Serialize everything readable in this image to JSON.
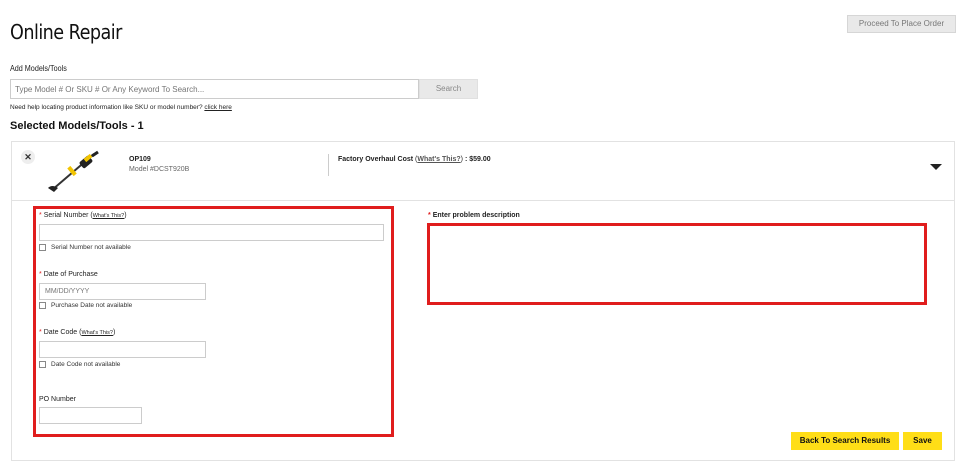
{
  "header": {
    "title": "Online Repair",
    "proceed_label": "Proceed To Place Order"
  },
  "search": {
    "label": "Add Models/Tools",
    "placeholder": "Type Model # Or SKU # Or Any Keyword To Search...",
    "button_label": "Search",
    "help_text": "Need help locating product information like SKU or model number?",
    "help_link": "click here"
  },
  "selected": {
    "title": "Selected Models/Tools - 1",
    "item": {
      "name": "OP109",
      "model": "Model #DCST920B",
      "cost_label": "Factory Overhaul Cost",
      "what_this": "What's This?",
      "cost_value": ": $59.00"
    }
  },
  "form": {
    "serial_label": "Serial Number",
    "serial_what": "What's This?",
    "serial_na": "Serial Number not available",
    "date_label": "Date of Purchase",
    "date_placeholder": "MM/DD/YYYY",
    "date_na": "Purchase Date not available",
    "code_label": "Date Code",
    "code_what": "What's This?",
    "code_na": "Date Code not available",
    "po_label": "PO Number",
    "problem_label": "Enter problem description"
  },
  "actions": {
    "back_label": "Back To Search Results",
    "save_label": "Save"
  },
  "colors": {
    "accent": "#ffde17",
    "highlight": "#e01d1d"
  }
}
